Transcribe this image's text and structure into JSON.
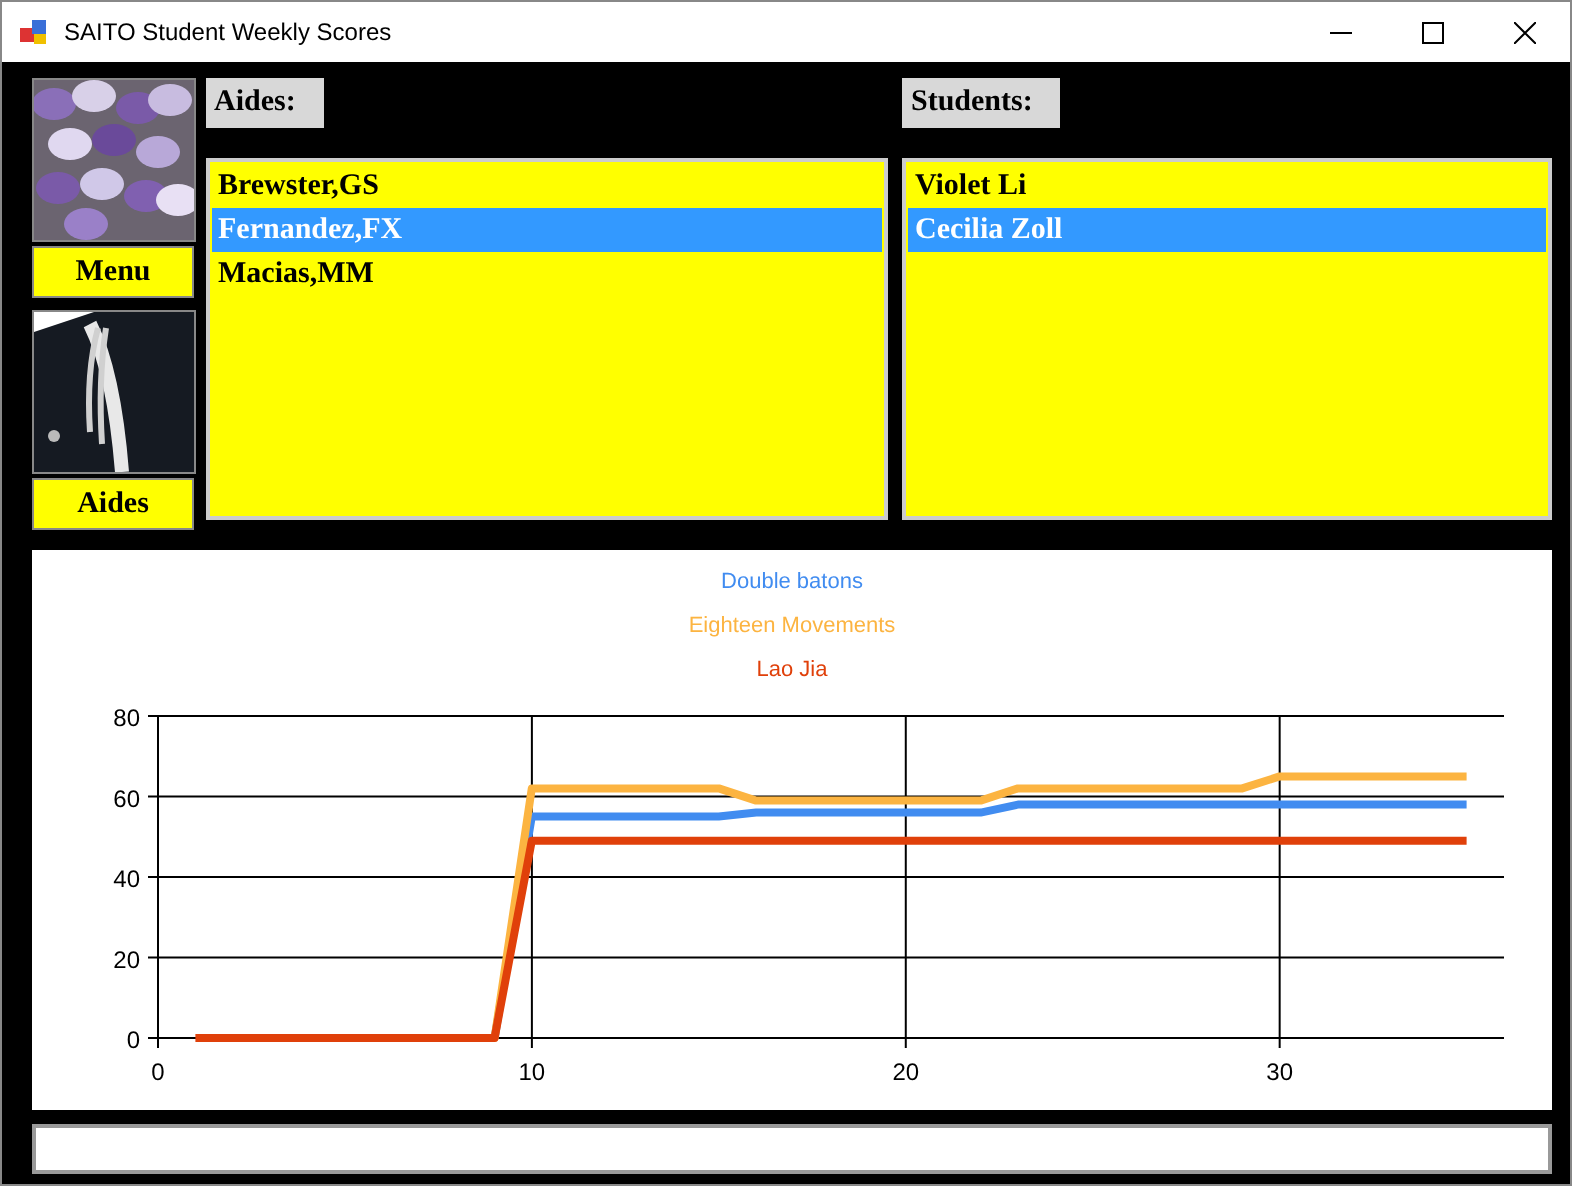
{
  "window": {
    "title": "SAITO Student Weekly Scores"
  },
  "nav_buttons": [
    {
      "label": "Menu"
    },
    {
      "label": "Aides"
    }
  ],
  "aides": {
    "label": "Aides:",
    "items": [
      {
        "text": "Brewster,GS",
        "selected": false
      },
      {
        "text": "Fernandez,FX",
        "selected": true
      },
      {
        "text": "Macias,MM",
        "selected": false
      }
    ]
  },
  "students": {
    "label": "Students:",
    "items": [
      {
        "text": "Violet Li",
        "selected": false
      },
      {
        "text": "Cecilia Zoll",
        "selected": true
      }
    ]
  },
  "chart": {
    "chart_data": {
      "type": "line",
      "grid": true,
      "x": [
        1,
        2,
        3,
        4,
        5,
        6,
        7,
        8,
        9,
        10,
        11,
        12,
        13,
        14,
        15,
        16,
        17,
        18,
        19,
        20,
        21,
        22,
        23,
        24,
        25,
        26,
        27,
        28,
        29,
        30,
        31,
        32,
        33,
        34,
        35
      ],
      "xlim": [
        0,
        36
      ],
      "ylim": [
        0,
        80
      ],
      "xticks": [
        0,
        10,
        20,
        30
      ],
      "yticks": [
        0,
        20,
        40,
        60,
        80
      ],
      "series": [
        {
          "name": "Double batons",
          "color": "#418cf0",
          "values": [
            null,
            null,
            null,
            null,
            null,
            null,
            null,
            null,
            0,
            55,
            55,
            55,
            55,
            55,
            55,
            56,
            56,
            56,
            56,
            56,
            56,
            56,
            58,
            58,
            58,
            58,
            58,
            58,
            58,
            58,
            58,
            58,
            58,
            58,
            58
          ]
        },
        {
          "name": "Eighteen Movements",
          "color": "#fcb441",
          "values": [
            null,
            null,
            null,
            null,
            null,
            null,
            null,
            0,
            0,
            62,
            62,
            62,
            62,
            62,
            62,
            59,
            59,
            59,
            59,
            59,
            59,
            59,
            62,
            62,
            62,
            62,
            62,
            62,
            62,
            65,
            65,
            65,
            65,
            65,
            65
          ]
        },
        {
          "name": "Lao Jia",
          "color": "#e0400a",
          "values": [
            0,
            0,
            0,
            0,
            0,
            0,
            0,
            0,
            0,
            49,
            49,
            49,
            49,
            49,
            49,
            49,
            49,
            49,
            49,
            49,
            49,
            49,
            49,
            49,
            49,
            49,
            49,
            49,
            49,
            49,
            49,
            49,
            49,
            49,
            49
          ]
        }
      ]
    }
  }
}
